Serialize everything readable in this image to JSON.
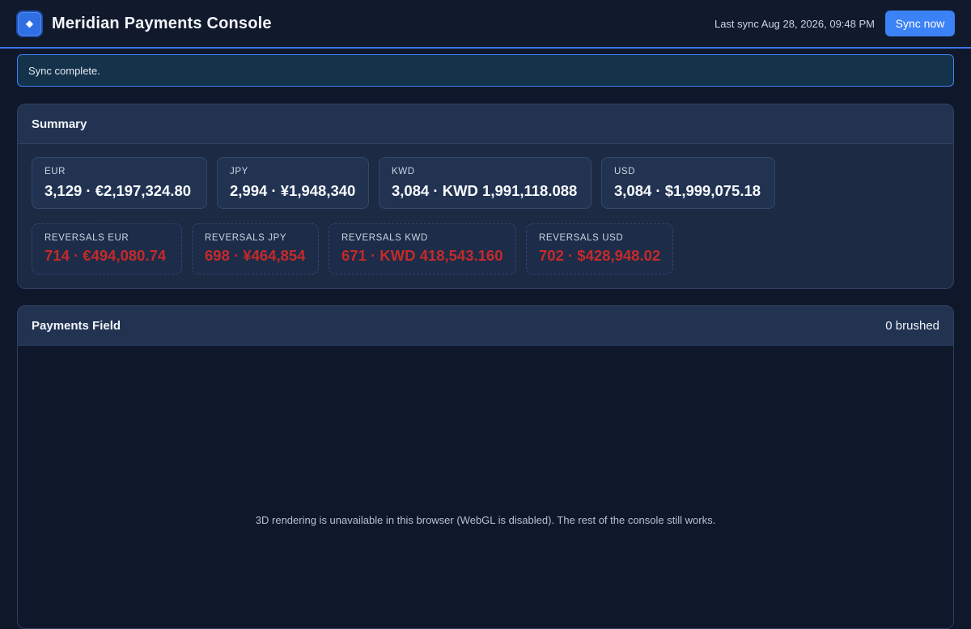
{
  "header": {
    "logo_glyph": "◆",
    "title": "Meridian Payments Console",
    "last_sync": "Last sync Aug 28, 2026, 09:48 PM",
    "sync_button": "Sync now"
  },
  "alert": {
    "message": "Sync complete."
  },
  "summary": {
    "title": "Summary",
    "totals": [
      {
        "label": "EUR",
        "value": "3,129 · €2,197,324.80"
      },
      {
        "label": "JPY",
        "value": "2,994 · ¥1,948,340"
      },
      {
        "label": "KWD",
        "value": "3,084 · KWD 1,991,118.088"
      },
      {
        "label": "USD",
        "value": "3,084 · $1,999,075.18"
      }
    ],
    "reversals": [
      {
        "label": "REVERSALS EUR",
        "value": "714 · €494,080.74"
      },
      {
        "label": "REVERSALS JPY",
        "value": "698 · ¥464,854"
      },
      {
        "label": "REVERSALS KWD",
        "value": "671 · KWD 418,543.160"
      },
      {
        "label": "REVERSALS USD",
        "value": "702 · $428,948.02"
      }
    ]
  },
  "payments_field": {
    "title": "Payments Field",
    "brushed": "0 brushed",
    "webgl_message": "3D rendering is unavailable in this browser (WebGL is disabled). The rest of the console still works."
  },
  "colors": {
    "accent": "#3b82f6",
    "reversal": "#c42a2a",
    "background": "#0f172a"
  }
}
